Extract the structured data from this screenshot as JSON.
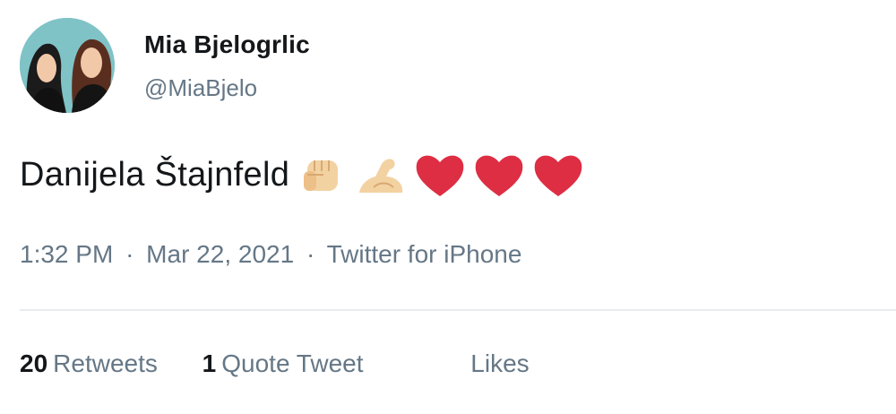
{
  "author": {
    "name": "Mia Bjelogrlic",
    "handle": "@MiaBjelo"
  },
  "tweet": {
    "text": "Danijela Štajnfeld",
    "emojis": [
      "raised-fist-icon",
      "flexed-biceps-icon",
      "red-heart-icon",
      "red-heart-icon",
      "red-heart-icon"
    ],
    "time": "1:32 PM",
    "date": "Mar 22, 2021",
    "source": "Twitter for iPhone",
    "separator": "·"
  },
  "stats": {
    "retweets_count": "20",
    "retweets_label": "Retweets",
    "quote_count": "1",
    "quote_label": "Quote Tweet",
    "likes_label": "Likes"
  },
  "colors": {
    "text_primary": "#14171a",
    "text_secondary": "#657786",
    "heart": "#dd2e44",
    "skin": "#f3d2a2",
    "avatar_bg": "#7fc3c7"
  }
}
